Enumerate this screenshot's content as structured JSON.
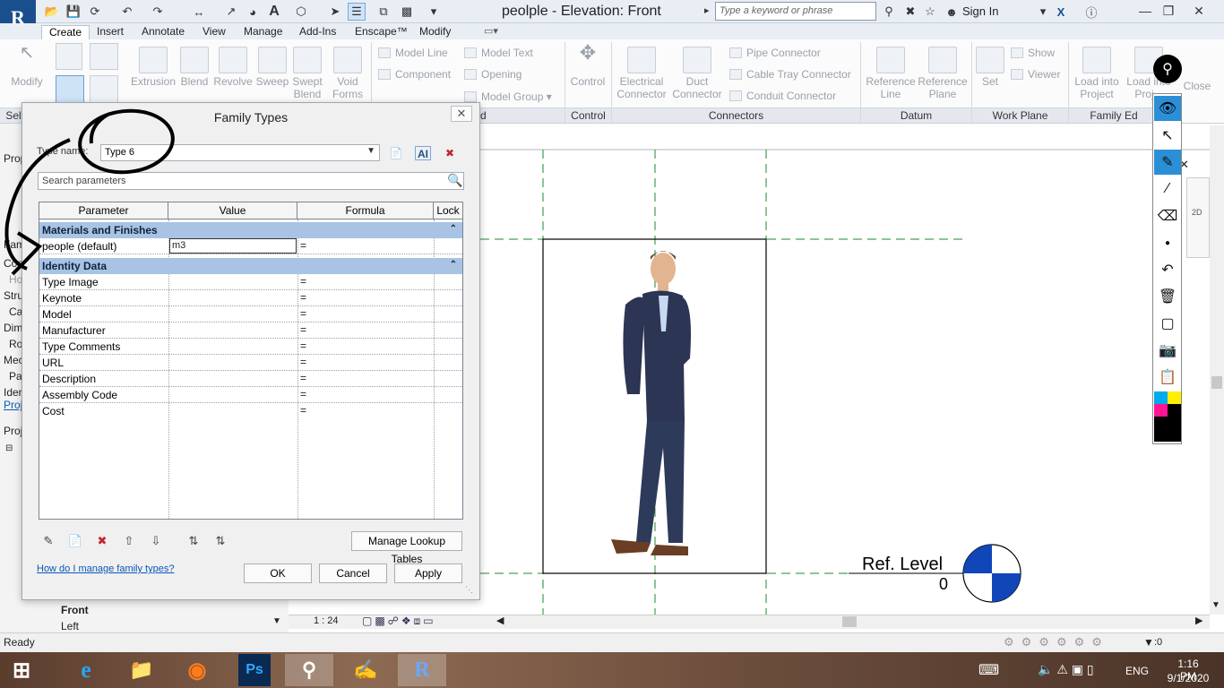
{
  "app": {
    "logo": "R",
    "window_title": "peolple - Elevation: Front",
    "search_placeholder": "Type a keyword or phrase",
    "sign_in": "Sign In"
  },
  "tabs": [
    "Create",
    "Insert",
    "Annotate",
    "View",
    "Manage",
    "Add-Ins",
    "Enscape™",
    "Modify"
  ],
  "ribbon": {
    "modify": "Modify",
    "forms": [
      {
        "name": "extrusion",
        "label": "Extrusion"
      },
      {
        "name": "blend",
        "label": "Blend"
      },
      {
        "name": "revolve",
        "label": "Revolve"
      },
      {
        "name": "sweep",
        "label": "Sweep"
      },
      {
        "name": "swept-blend",
        "label": "Swept\nBlend"
      },
      {
        "name": "void-forms",
        "label": "Void\nForms"
      }
    ],
    "model_small": [
      "Model Line",
      "Component",
      "Model Text",
      "Opening",
      "Model Group"
    ],
    "control": "Control",
    "connectors_big": [
      "Electrical\nConnector",
      "Duct\nConnector"
    ],
    "connectors_small": [
      "Pipe  Connector",
      "Cable Tray  Connector",
      "Conduit  Connector"
    ],
    "datum_big": [
      "Reference\nLine",
      "Reference\nPlane"
    ],
    "workplane_big": "Set",
    "workplane_small": [
      "Show",
      "Viewer"
    ],
    "family_big": [
      "Load into\nProject",
      "Load into\nProj...",
      "Close"
    ],
    "panels": {
      "select": "Sel",
      "model": "d",
      "control": "Control",
      "connectors": "Connectors",
      "datum": "Datum",
      "workplane": "Work Plane",
      "family": "Family Ed"
    }
  },
  "left_panel": {
    "props_label": "Prop",
    "items": [
      "Fam",
      "Con",
      "Ho",
      "Stru",
      "Ca",
      "Dim",
      "Ro",
      "Mec",
      "Pa",
      "Iden",
      "Proj"
    ],
    "project_label": "Proj",
    "tree_front": "Front",
    "tree_left": "Left"
  },
  "dialog": {
    "title": "Family Types",
    "type_name_label": "Type name:",
    "type_name_value": "Type 6",
    "search_placeholder": "Search parameters",
    "columns": [
      "Parameter",
      "Value",
      "Formula",
      "Lock"
    ],
    "groups": [
      {
        "label": "Materials and Finishes",
        "rows": [
          {
            "param": "people (default)",
            "value": "m3",
            "formula": "="
          }
        ]
      },
      {
        "label": "Identity Data",
        "rows": [
          {
            "param": "Type Image",
            "value": "",
            "formula": "="
          },
          {
            "param": "Keynote",
            "value": "",
            "formula": "="
          },
          {
            "param": "Model",
            "value": "",
            "formula": "="
          },
          {
            "param": "Manufacturer",
            "value": "",
            "formula": "="
          },
          {
            "param": "Type Comments",
            "value": "",
            "formula": "="
          },
          {
            "param": "URL",
            "value": "",
            "formula": "="
          },
          {
            "param": "Description",
            "value": "",
            "formula": "="
          },
          {
            "param": "Assembly Code",
            "value": "",
            "formula": "="
          },
          {
            "param": "Cost",
            "value": "",
            "formula": "="
          }
        ]
      }
    ],
    "manage_lookup": "Manage Lookup Tables",
    "help_link": "How do I manage family types?",
    "ok": "OK",
    "cancel": "Cancel",
    "apply": "Apply"
  },
  "drawing": {
    "ref_level_label": "Ref. Level",
    "ref_level_value": "0"
  },
  "view_bar": {
    "scale": "1 : 24"
  },
  "status": {
    "text": "Ready",
    "filter_count": ":0"
  },
  "taskbar": {
    "lang": "ENG",
    "time": "1:16 PM",
    "date": "9/1/2020"
  },
  "colors": {
    "revit_blue": "#1a4f8e",
    "group_header": "#a8c3e4",
    "selected_tool": "#2a8fd6"
  }
}
